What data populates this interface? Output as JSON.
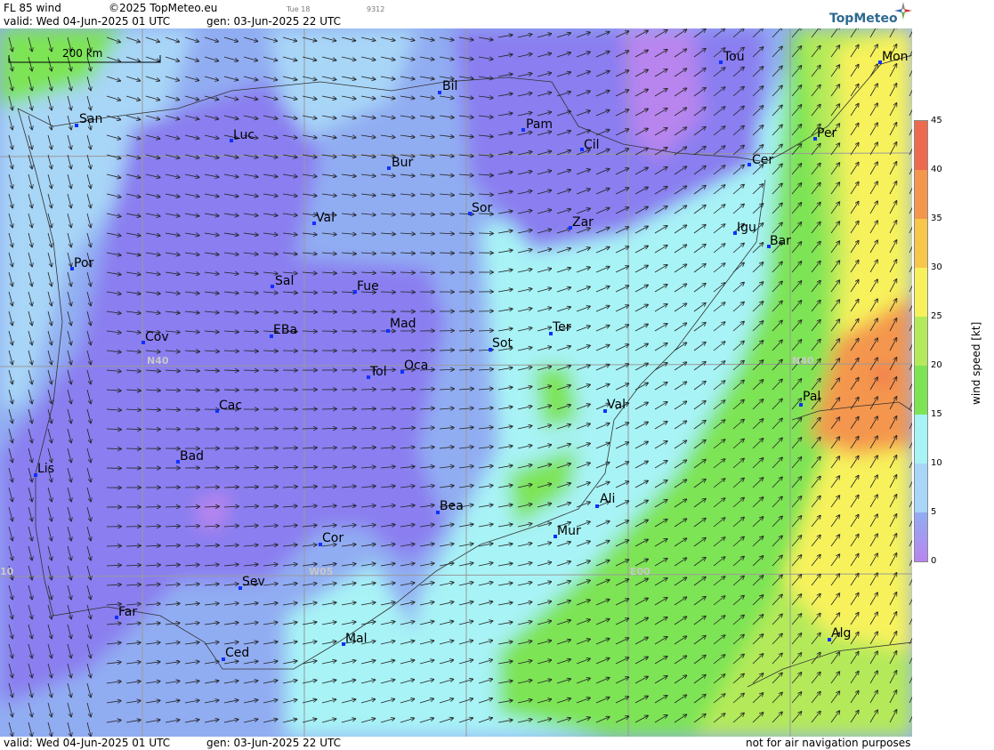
{
  "header": {
    "product": "FL 85 wind",
    "copyright": "©2025 TopMeteo.eu",
    "tiny_time": "Tue 18",
    "tiny_code": "9312",
    "valid": "valid:  Wed  04-Jun-2025  01 UTC",
    "gen": "gen: 03-Jun-2025 22 UTC",
    "logo": "TopMeteo"
  },
  "footer": {
    "valid": "valid:  Wed  04-Jun-2025  01 UTC",
    "gen": "gen: 03-Jun-2025 22 UTC",
    "disclaimer": "not for air navigation purposes"
  },
  "map": {
    "scale_label": "200 km",
    "grid_labels": [
      "N40",
      "N40",
      "W05",
      "E00",
      "10"
    ],
    "cities": [
      "San",
      "Luc",
      "Bil",
      "Pam",
      "Tou",
      "Mon",
      "Cil",
      "Per",
      "Cer",
      "Bur",
      "Sor",
      "Val",
      "Zar",
      "Igu",
      "Bar",
      "Por",
      "Sal",
      "Fue",
      "Mad",
      "Cov",
      "EBa",
      "Sot",
      "Ter",
      "Tol",
      "Oca",
      "Pal",
      "Val",
      "Cac",
      "Bad",
      "Lis",
      "Ali",
      "Bea",
      "Mur",
      "Cor",
      "Sev",
      "Far",
      "Mal",
      "Alg",
      "Ced"
    ]
  },
  "legend": {
    "title": "wind speed [kt]",
    "ticks": [
      "45",
      "40",
      "35",
      "30",
      "25",
      "20",
      "15",
      "10",
      "5",
      "0"
    ],
    "colors": [
      "#ee6a4f",
      "#f4964e",
      "#f7c64a",
      "#f7f25c",
      "#b4ea5a",
      "#7de454",
      "#a8f3f6",
      "#a8d6f7",
      "#91adf2",
      "#8a7ef0",
      "#b885ee"
    ]
  }
}
